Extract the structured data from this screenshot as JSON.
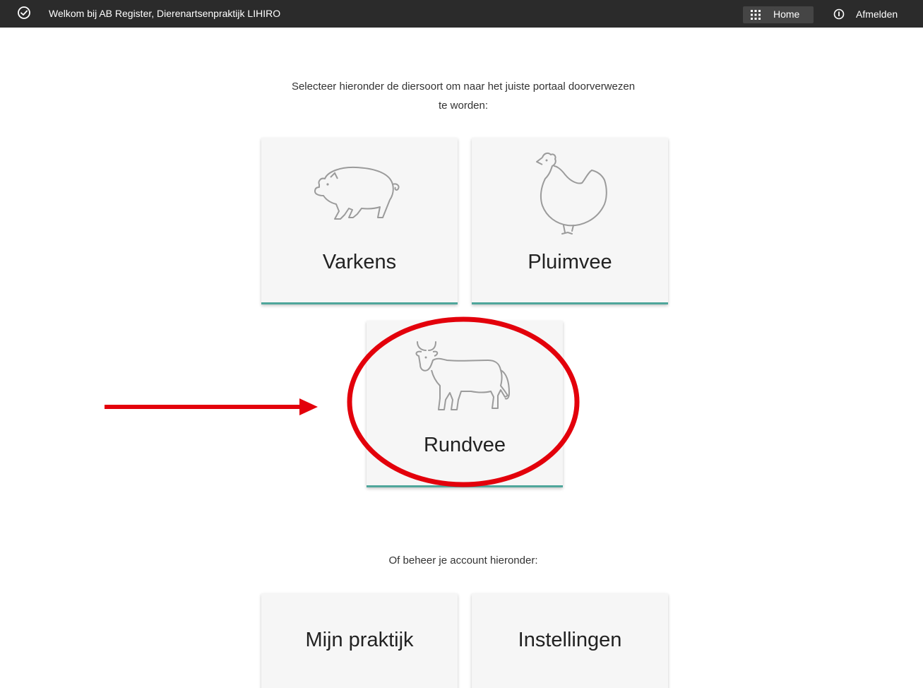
{
  "header": {
    "welcome_text": "Welkom bij AB Register, Dierenartsenpraktijk LIHIRO",
    "status_icon": "check-circle-icon",
    "home_label": "Home",
    "home_icon": "grid-icon",
    "logout_label": "Afmelden",
    "logout_icon": "info-icon"
  },
  "main": {
    "intro_line1": "Selecteer hieronder de diersoort om naar het juiste portaal doorverwezen",
    "intro_line2": "te worden:",
    "species": [
      {
        "label": "Varkens",
        "icon": "pig-icon"
      },
      {
        "label": "Pluimvee",
        "icon": "chicken-icon"
      },
      {
        "label": "Rundvee",
        "icon": "cow-icon"
      }
    ],
    "account_intro": "Of beheer je account hieronder:",
    "account_tiles": [
      {
        "label": "Mijn praktijk"
      },
      {
        "label": "Instellingen"
      }
    ]
  },
  "colors": {
    "topbar": "#2b2b2b",
    "tile_accent": "#4fa69b",
    "annotation": "#e3000b"
  }
}
